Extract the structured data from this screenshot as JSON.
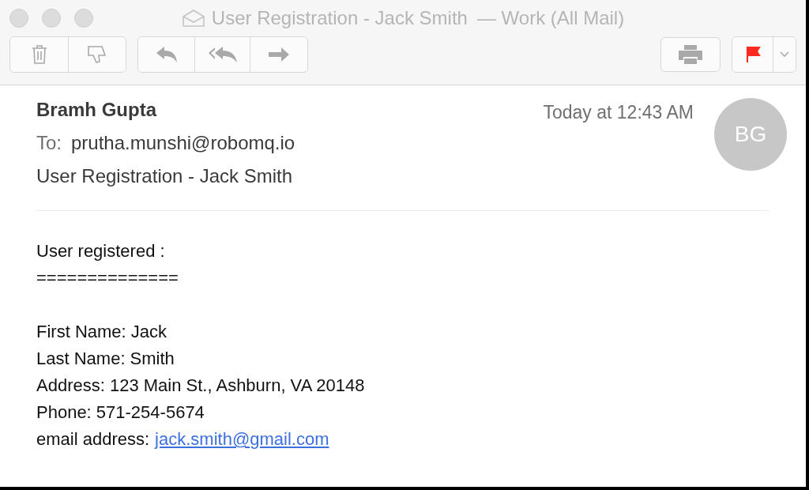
{
  "window": {
    "title": "User Registration - Jack Smith",
    "mailbox": "— Work (All Mail)"
  },
  "message": {
    "sender": "Bramh Gupta",
    "date": "Today at 12:43 AM",
    "to_label": "To:",
    "to": "prutha.munshi@robomq.io",
    "subject": "User Registration - Jack Smith",
    "avatar": "BG"
  },
  "body": {
    "lines": [
      {
        "kind": "text",
        "text": "User registered :"
      },
      {
        "kind": "text",
        "text": "=============="
      },
      {
        "kind": "blank"
      },
      {
        "kind": "text",
        "text": "First Name: Jack"
      },
      {
        "kind": "text",
        "text": "Last Name: Smith"
      },
      {
        "kind": "text",
        "text": "Address: 123 Main St., Ashburn, VA 20148"
      },
      {
        "kind": "text",
        "text": "Phone: 571-254-5674"
      },
      {
        "kind": "link",
        "text": "email address:",
        "link": "jack.smith@gmail.com"
      }
    ]
  }
}
